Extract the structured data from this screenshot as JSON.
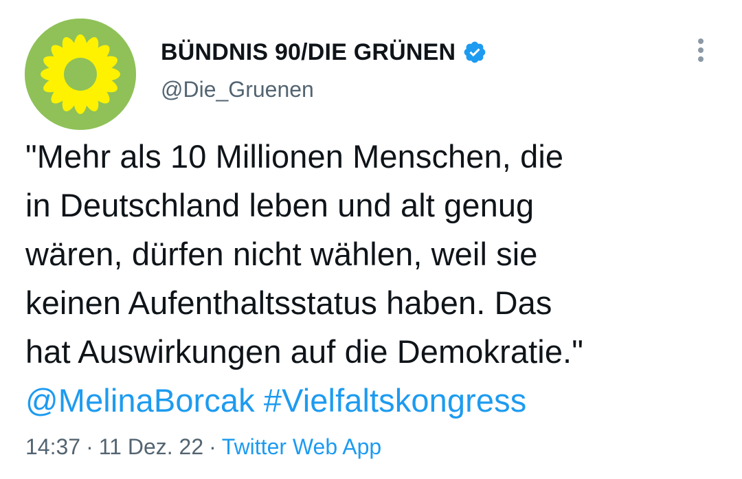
{
  "author": {
    "display_name": "BÜNDNIS 90/DIE GRÜNEN",
    "handle": "@Die_Gruenen",
    "verified": true,
    "avatar_icon": "sunflower-icon",
    "avatar_bg": "#8fc158",
    "avatar_flower": "#fff200"
  },
  "tweet": {
    "lines": [
      "\"Mehr als 10 Millionen Menschen, die",
      "in Deutschland leben und alt genug",
      "wären, dürfen nicht wählen, weil sie",
      "keinen Aufenthaltsstatus haben. Das",
      "hat Auswirkungen auf die Demokratie.\""
    ],
    "mention": "@MelinaBorcak",
    "hashtag": "#Vielfaltskongress",
    "time": "14:37",
    "date": "11 Dez. 22",
    "separator": "·",
    "source": "Twitter Web App"
  },
  "colors": {
    "link": "#1d9bf0",
    "secondary_text": "#536471",
    "verified_badge": "#1d9bf0"
  },
  "icons": {
    "more": "more-vertical-icon",
    "verified": "verified-badge-icon"
  }
}
